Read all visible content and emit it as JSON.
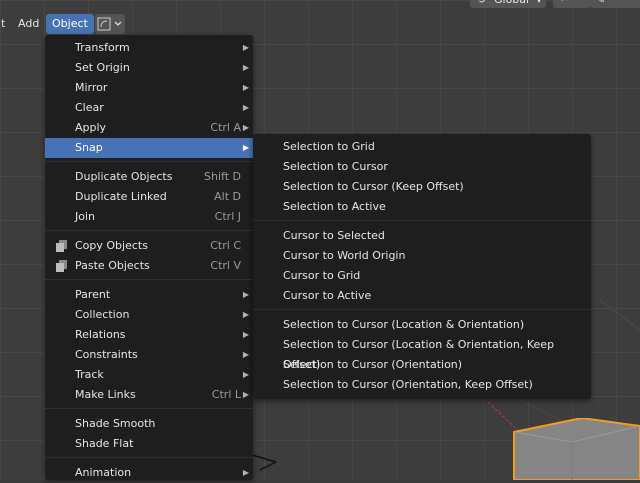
{
  "header": {
    "items": [
      "t",
      "Add",
      "Object"
    ],
    "active": "Object",
    "orientation_label": "Global"
  },
  "object_menu": {
    "items": [
      {
        "label": "Transform",
        "shortcut": "",
        "submenu": true
      },
      {
        "label": "Set Origin",
        "shortcut": "",
        "submenu": true
      },
      {
        "label": "Mirror",
        "shortcut": "",
        "submenu": true
      },
      {
        "label": "Clear",
        "shortcut": "",
        "submenu": true
      },
      {
        "label": "Apply",
        "shortcut": "Ctrl A",
        "submenu": true
      },
      {
        "label": "Snap",
        "shortcut": "",
        "submenu": true
      },
      {
        "label": "Duplicate Objects",
        "shortcut": "Shift D",
        "submenu": false
      },
      {
        "label": "Duplicate Linked",
        "shortcut": "Alt D",
        "submenu": false
      },
      {
        "label": "Join",
        "shortcut": "Ctrl J",
        "submenu": false
      },
      {
        "label": "Copy Objects",
        "shortcut": "Ctrl C",
        "submenu": false,
        "icon": "copy-icon"
      },
      {
        "label": "Paste Objects",
        "shortcut": "Ctrl V",
        "submenu": false,
        "icon": "paste-icon"
      },
      {
        "label": "Parent",
        "shortcut": "",
        "submenu": true
      },
      {
        "label": "Collection",
        "shortcut": "",
        "submenu": true
      },
      {
        "label": "Relations",
        "shortcut": "",
        "submenu": true
      },
      {
        "label": "Constraints",
        "shortcut": "",
        "submenu": true
      },
      {
        "label": "Track",
        "shortcut": "",
        "submenu": true
      },
      {
        "label": "Make Links",
        "shortcut": "Ctrl L",
        "submenu": true
      },
      {
        "label": "Shade Smooth",
        "shortcut": "",
        "submenu": false
      },
      {
        "label": "Shade Flat",
        "shortcut": "",
        "submenu": false
      },
      {
        "label": "Animation",
        "shortcut": "",
        "submenu": true
      }
    ],
    "highlighted": "Snap"
  },
  "snap_menu": {
    "items": [
      "Selection to Grid",
      "Selection to Cursor",
      "Selection to Cursor (Keep Offset)",
      "Selection to Active",
      "Cursor to Selected",
      "Cursor to World Origin",
      "Cursor to Grid",
      "Cursor to Active",
      "Selection to Cursor (Location & Orientation)",
      "Selection to Cursor (Location & Orientation, Keep Offset)",
      "Selection to Cursor (Orientation)",
      "Selection to Cursor (Orientation, Keep Offset)"
    ]
  },
  "colors": {
    "highlight": "#4772b3",
    "menu_bg": "#1e1e1e",
    "cube_outline": "#f59a23",
    "axis_red": "#c8383a"
  }
}
